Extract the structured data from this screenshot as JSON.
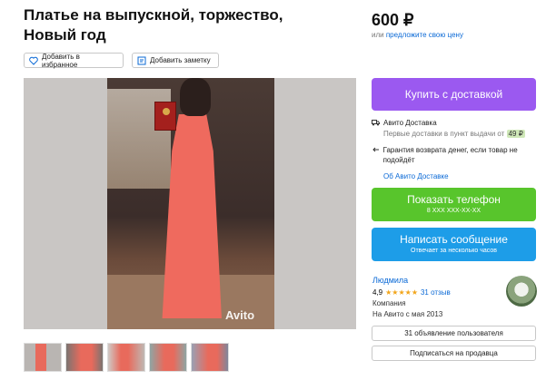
{
  "listing": {
    "title": "Платье на выпускной, торжество, Новый год",
    "price": "600 ₽",
    "offer_prefix": "или",
    "offer_link": "предложите свою цену"
  },
  "actions": {
    "favorite_label": "Добавить в избранное",
    "note_label": "Добавить заметку"
  },
  "gallery": {
    "watermark": "Avito",
    "thumbnail_count": 5
  },
  "purchase": {
    "buy_label": "Купить с доставкой",
    "delivery_title": "Авито Доставка",
    "delivery_sub": "Первые доставки в пункт выдачи от",
    "delivery_price": "49 ₽",
    "guarantee": "Гарантия возврата денег, если товар не подойдёт",
    "about_link": "Об Авито Доставке"
  },
  "contact": {
    "phone_label": "Показать телефон",
    "phone_number": "8 XXX XXX-XX-XX",
    "message_label": "Написать сообщение",
    "message_sub": "Отвечает за несколько часов"
  },
  "seller": {
    "name": "Людмила",
    "rating": "4,9",
    "stars": "★★★★★",
    "reviews": "31 отзыв",
    "type": "Компания",
    "since": "На Авито с мая 2013",
    "ads_label": "31 объявление пользователя",
    "subscribe_label": "Подписаться на продавца"
  },
  "colors": {
    "buy": "#9b59f0",
    "phone": "#58c52c",
    "message": "#1d9de8",
    "link": "#0a69d6"
  }
}
